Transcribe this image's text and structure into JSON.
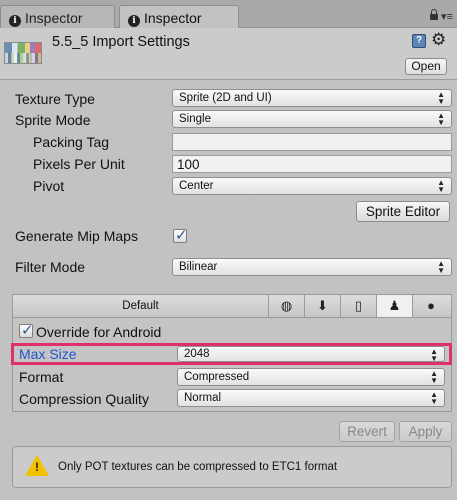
{
  "tabs": [
    {
      "label": "Inspector",
      "active": false
    },
    {
      "label": "Inspector",
      "active": true
    }
  ],
  "header": {
    "title": "5.5_5 Import Settings",
    "open_label": "Open",
    "help_icon": "help-icon",
    "settings_icon": "gear-icon"
  },
  "settings": {
    "texture_type": {
      "label": "Texture Type",
      "value": "Sprite (2D and UI)"
    },
    "sprite_mode": {
      "label": "Sprite Mode",
      "value": "Single"
    },
    "packing_tag": {
      "label": "Packing Tag",
      "value": ""
    },
    "pixels_per_unit": {
      "label": "Pixels Per Unit",
      "value": "100"
    },
    "pivot": {
      "label": "Pivot",
      "value": "Center"
    },
    "sprite_editor_label": "Sprite Editor",
    "generate_mip_maps": {
      "label": "Generate Mip Maps",
      "checked": true
    },
    "filter_mode": {
      "label": "Filter Mode",
      "value": "Bilinear"
    }
  },
  "platform": {
    "default_tab": "Default",
    "tab_icons": [
      "globe-icon",
      "download-icon",
      "phone-icon",
      "android-icon",
      "blackberry-icon"
    ],
    "active_tab": "android",
    "override_label": "Override for Android",
    "override_checked": true,
    "max_size": {
      "label": "Max Size",
      "value": "2048"
    },
    "format": {
      "label": "Format",
      "value": "Compressed"
    },
    "compression_quality": {
      "label": "Compression Quality",
      "value": "Normal"
    }
  },
  "actions": {
    "revert_label": "Revert",
    "apply_label": "Apply"
  },
  "warning": {
    "text": "Only POT textures can be compressed to ETC1 format"
  },
  "colors": {
    "highlight": "#e0306a",
    "selected_label": "#2255cc",
    "warning_icon": "#f2c200"
  }
}
